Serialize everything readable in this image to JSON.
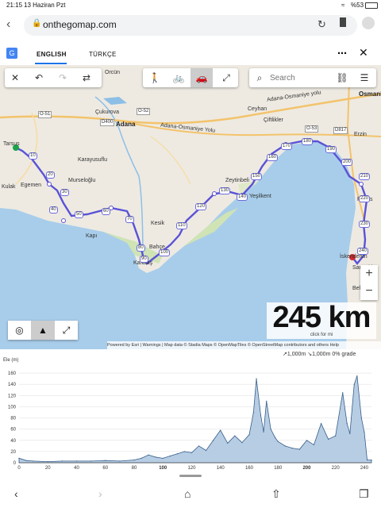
{
  "status": {
    "time": "21:15",
    "date": "13 Haziran Pzt",
    "battery": "%53"
  },
  "browser": {
    "url": "onthegomap.com"
  },
  "translate": {
    "tab_english": "ENGLISH",
    "tab_turkish": "TÜRKÇE"
  },
  "toolbar": {
    "search_placeholder": "Search"
  },
  "map": {
    "labels": {
      "adana": "Adana",
      "orcun": "Orcün",
      "cukurova": "Çukurova",
      "ceyhan": "Ceyhan",
      "ciftlikler": "Çiftlikler",
      "karayusuflu": "Karayusuflu",
      "murseloglu": "Murseloğlu",
      "egemen": "Egemen",
      "kulak": "Kulak",
      "tarsus": "Tarsus",
      "zeytinbeli": "Zeytinbeli",
      "kesik": "Kesik",
      "bahce": "Bahçe",
      "karatas": "Karataş",
      "kapi": "Kapı",
      "yesilkent": "Yeşilkent",
      "erzin": "Erzin",
      "payas": "Payas",
      "iskenderun": "İskenderun",
      "sariseki": "Sarıseki",
      "belen": "Belen",
      "osmaniye": "Osmani",
      "hw1": "Adana-Osmaniye Yolu",
      "hw2": "Adana-Osmaniye yolu",
      "d400": "D400",
      "o51": "O-51",
      "o52": "O-52",
      "o53": "O-53",
      "d817": "D817"
    },
    "route_markers": [
      "10",
      "20",
      "30",
      "40",
      "50",
      "60",
      "70",
      "80",
      "90",
      "100",
      "110",
      "120",
      "130",
      "140",
      "150",
      "160",
      "170",
      "180",
      "190",
      "200",
      "210",
      "220",
      "230",
      "240"
    ]
  },
  "distance": {
    "value": "245 km",
    "sub": "click for mi"
  },
  "attribution": "Powered by Esri | Warnings | Map data © Stadia Maps © OpenMapTiles © OpenStreetMap contributors and others Help",
  "elevation": {
    "ylabel": "Ele (m)",
    "stats": {
      "ascent": "1,000m",
      "descent": "1,000m",
      "grade": "0% grade"
    },
    "yticks": [
      "0",
      "20",
      "40",
      "60",
      "80",
      "100",
      "120",
      "140",
      "160"
    ],
    "xticks": [
      "0",
      "20",
      "40",
      "60",
      "80",
      "100",
      "120",
      "140",
      "160",
      "180",
      "200",
      "220",
      "240"
    ]
  },
  "chart_data": {
    "type": "area",
    "xlabel": "",
    "ylabel": "Ele (m)",
    "xlim": [
      0,
      245
    ],
    "ylim": [
      0,
      170
    ],
    "x": [
      0,
      5,
      10,
      20,
      30,
      40,
      50,
      60,
      70,
      80,
      85,
      90,
      95,
      100,
      105,
      110,
      115,
      120,
      125,
      130,
      135,
      140,
      145,
      150,
      155,
      160,
      163,
      165,
      168,
      170,
      172,
      175,
      178,
      180,
      185,
      190,
      195,
      200,
      205,
      210,
      215,
      220,
      225,
      228,
      230,
      233,
      235,
      238,
      240,
      242,
      245
    ],
    "values": [
      8,
      4,
      3,
      2,
      3,
      3,
      3,
      4,
      3,
      5,
      8,
      14,
      10,
      8,
      12,
      16,
      20,
      18,
      30,
      22,
      40,
      58,
      35,
      48,
      36,
      50,
      90,
      150,
      85,
      55,
      110,
      60,
      45,
      38,
      30,
      26,
      24,
      40,
      32,
      70,
      42,
      48,
      125,
      70,
      52,
      140,
      155,
      80,
      55,
      5,
      5
    ]
  }
}
